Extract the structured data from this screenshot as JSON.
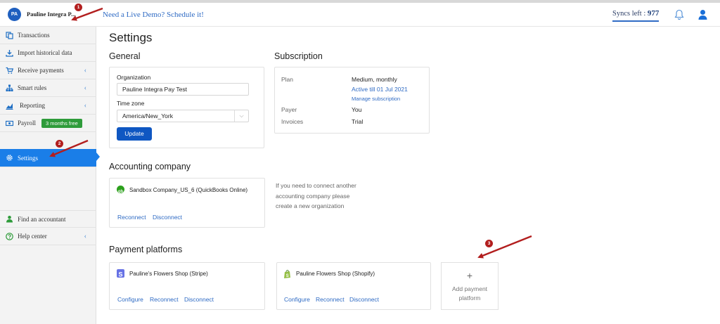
{
  "header": {
    "avatar_initials": "PA",
    "org_name": "Pauline Integra P...",
    "demo_link": "Need a Live Demo? Schedule it!",
    "syncs_label": "Syncs left :",
    "syncs_value": "977"
  },
  "sidebar": {
    "items": [
      {
        "label": "Transactions",
        "icon": "copy-icon"
      },
      {
        "label": "Import historical data",
        "icon": "download-icon"
      },
      {
        "label": "Receive payments",
        "icon": "cart-icon"
      },
      {
        "label": "Smart rules",
        "icon": "hierarchy-icon"
      },
      {
        "label": "Reporting",
        "icon": "chart-icon"
      },
      {
        "label": "Payroll",
        "icon": "money-icon",
        "badge": "3 months free"
      },
      {
        "label": "Settings",
        "icon": "gear-icon"
      },
      {
        "label": "Find an accountant",
        "icon": "person-icon"
      },
      {
        "label": "Help center",
        "icon": "help-icon"
      }
    ]
  },
  "main": {
    "title": "Settings",
    "general": {
      "title": "General",
      "org_label": "Organization",
      "org_value": "Pauline Integra Pay Test",
      "tz_label": "Time zone",
      "tz_value": "America/New_York",
      "update_label": "Update"
    },
    "subscription": {
      "title": "Subscription",
      "plan_label": "Plan",
      "plan_value": "Medium, monthly",
      "active_text": "Active till 01 Jul 2021",
      "manage_link": "Manage subscription",
      "payer_label": "Payer",
      "payer_value": "You",
      "invoices_label": "Invoices",
      "invoices_value": "Trial"
    },
    "accounting": {
      "title": "Accounting company",
      "company_name": "Sandbox Company_US_6 (QuickBooks Online)",
      "reconnect": "Reconnect",
      "disconnect": "Disconnect",
      "info_text": "If you need to connect another accounting company please create a new organization"
    },
    "payment_platforms": {
      "title": "Payment platforms",
      "platforms": [
        {
          "name": "Pauline's Flowers Shop (Stripe)",
          "configure": "Configure",
          "reconnect": "Reconnect",
          "disconnect": "Disconnect"
        },
        {
          "name": "Pauline Flowers Shop (Shopify)",
          "configure": "Configure",
          "reconnect": "Reconnect",
          "disconnect": "Disconnect"
        }
      ],
      "add_plus": "+",
      "add_label": "Add payment platform"
    }
  },
  "annotations": [
    "1",
    "2",
    "3"
  ],
  "colors": {
    "accent": "#1a7ee8",
    "button": "#0f57c2",
    "badge_green": "#2e9b3a",
    "annotation_red": "#b21e1e"
  }
}
